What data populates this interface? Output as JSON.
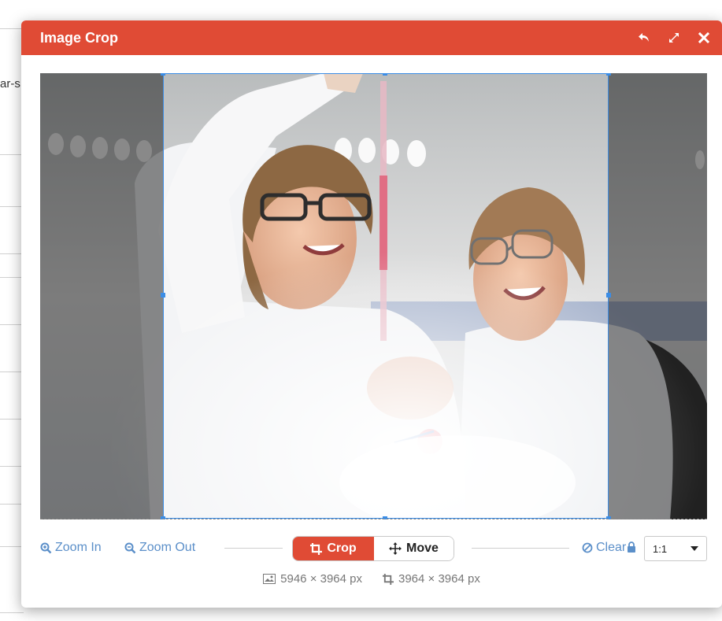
{
  "background": {
    "snippet": "ar-s"
  },
  "modal": {
    "title": "Image Crop",
    "actions": {
      "undo_icon": "undo-icon",
      "expand_icon": "expand-icon",
      "close_icon": "close-icon"
    }
  },
  "toolbar": {
    "zoom_in_label": "Zoom In",
    "zoom_out_label": "Zoom Out",
    "crop_label": "Crop",
    "move_label": "Move",
    "clear_label": "Clear",
    "aspect_ratio_value": "1:1",
    "mode_selected": "Crop"
  },
  "info": {
    "original_size": "5946 × 3964 px",
    "crop_size": "3964 × 3964 px"
  },
  "colors": {
    "accent": "#e04b35",
    "crop_border": "#3b8de6",
    "link": "#5b8fc9"
  }
}
